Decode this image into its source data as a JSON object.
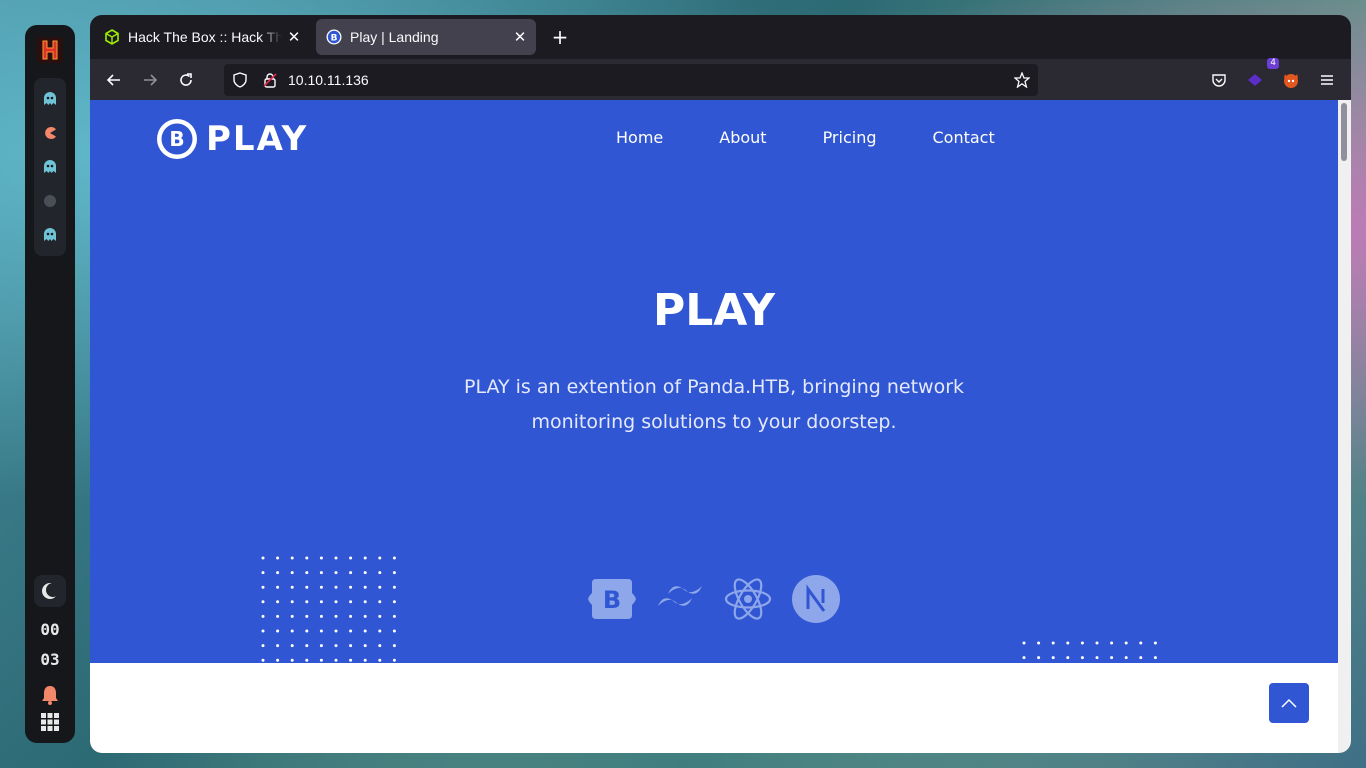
{
  "dock": {
    "clock_hours": "00",
    "clock_minutes": "03"
  },
  "tabs": [
    {
      "title": "Hack The Box :: Hack The Box",
      "icon": "htb-cube-icon"
    },
    {
      "title": "Play | Landing",
      "icon": "bootstrap-b-icon"
    }
  ],
  "navbar": {
    "url": "10.10.11.136",
    "extension_badge": "4"
  },
  "site": {
    "brand": "PLAY",
    "brand_badge": "B",
    "menu": [
      "Home",
      "About",
      "Pricing",
      "Contact"
    ],
    "hero_title": "PLAY",
    "hero_text": "PLAY is an extention of Panda.HTB, bringing network monitoring solutions to your doorstep.",
    "tech_icons": [
      "bootstrap-icon",
      "tailwind-icon",
      "react-icon",
      "nextjs-icon"
    ],
    "accent": "#3056d3"
  }
}
